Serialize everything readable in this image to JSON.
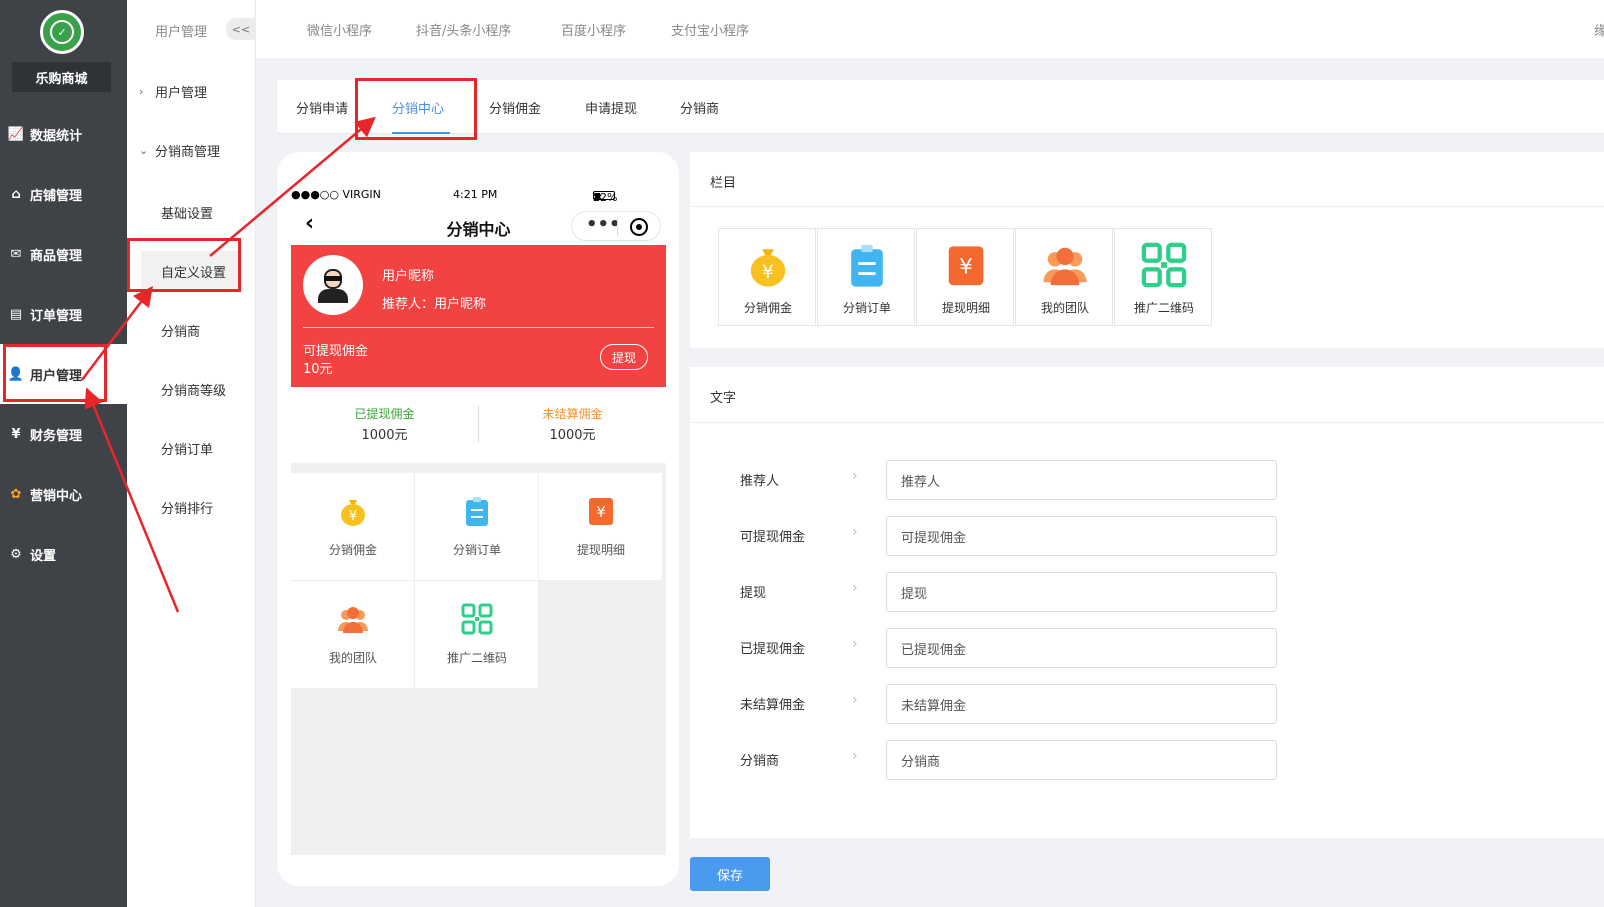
{
  "sidebar": {
    "shop_name": "乐购商城",
    "items": [
      {
        "label": "数据统计",
        "icon": "chart-icon"
      },
      {
        "label": "店铺管理",
        "icon": "store-icon"
      },
      {
        "label": "商品管理",
        "icon": "goods-icon"
      },
      {
        "label": "订单管理",
        "icon": "order-icon"
      },
      {
        "label": "用户管理",
        "icon": "user-icon"
      },
      {
        "label": "财务管理",
        "icon": "finance-icon"
      },
      {
        "label": "营销中心",
        "icon": "marketing-icon"
      },
      {
        "label": "设置",
        "icon": "settings-icon"
      }
    ],
    "active_index": 4
  },
  "subnav": {
    "header": "用户管理",
    "collapse": "<<",
    "groups": [
      {
        "label": "用户管理"
      },
      {
        "label": "分销商管理"
      }
    ],
    "items": [
      "基础设置",
      "自定义设置",
      "分销商",
      "分销商等级",
      "分销订单",
      "分销排行"
    ],
    "active_item": "自定义设置"
  },
  "topbar": {
    "tabs": [
      "微信小程序",
      "抖音/头条小程序",
      "百度小程序",
      "支付宝小程序"
    ],
    "right_text": "缘"
  },
  "tabs": {
    "items": [
      "分销申请",
      "分销中心",
      "分销佣金",
      "申请提现",
      "分销商"
    ],
    "active": "分销中心"
  },
  "phone": {
    "status": {
      "carrier": "●●●○○ VIRGIN",
      "time": "4:21 PM",
      "battery": "22%"
    },
    "title": "分销中心",
    "nickname": "用户昵称",
    "recommender": "推荐人：用户昵称",
    "withdrawable_label": "可提现佣金",
    "withdrawable_value": "10元",
    "withdraw_button": "提现",
    "stats": [
      {
        "label": "已提现佣金",
        "value": "1000元",
        "color": "#3aa537"
      },
      {
        "label": "未结算佣金",
        "value": "1000元",
        "color": "#f5902a"
      }
    ],
    "grid": [
      "分销佣金",
      "分销订单",
      "提现明细",
      "我的团队",
      "推广二维码"
    ]
  },
  "columns_panel": {
    "title": "栏目",
    "items": [
      "分销佣金",
      "分销订单",
      "提现明细",
      "我的团队",
      "推广二维码"
    ]
  },
  "text_panel": {
    "title": "文字",
    "fields": [
      {
        "label": "推荐人",
        "value": "推荐人"
      },
      {
        "label": "可提现佣金",
        "value": "可提现佣金"
      },
      {
        "label": "提现",
        "value": "提现"
      },
      {
        "label": "已提现佣金",
        "value": "已提现佣金"
      },
      {
        "label": "未结算佣金",
        "value": "未结算佣金"
      },
      {
        "label": "分销商",
        "value": "分销商"
      }
    ]
  },
  "save_button": "保存",
  "colors": {
    "accent": "#4a90e2",
    "red": "#f24242",
    "annotation": "#e8262a"
  }
}
